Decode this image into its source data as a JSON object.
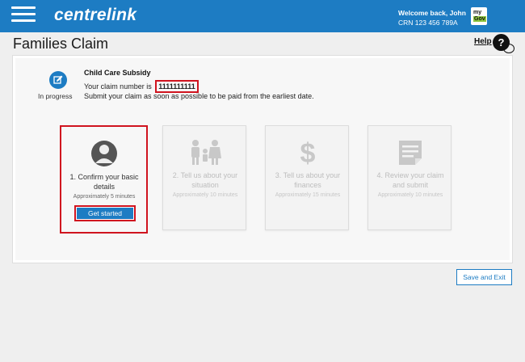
{
  "header": {
    "brand": "centrelink",
    "welcome": "Welcome back, John",
    "crn": "CRN 123 456 789A",
    "mygov_top": "my",
    "mygov_bottom": "Gov"
  },
  "page": {
    "title": "Families Claim",
    "help_label": "Help",
    "help_icon_glyph": "?"
  },
  "claim": {
    "status_label": "In progress",
    "title": "Child Care Subsidy",
    "number_prefix": "Your claim number is",
    "number": "1111111111",
    "submit_note": "Submit your claim as soon as possible to be paid from the earliest date."
  },
  "steps": [
    {
      "title": "1. Confirm your basic details",
      "duration": "Approximately 5 minutes",
      "icon": "person-icon",
      "active": true,
      "button_label": "Get started"
    },
    {
      "title": "2. Tell us about your situation",
      "duration": "Approximately 10 minutes",
      "icon": "family-icon",
      "active": false
    },
    {
      "title": "3. Tell us about your finances",
      "duration": "Approximately 15 minutes",
      "icon": "dollar-icon",
      "active": false
    },
    {
      "title": "4. Review your claim and submit",
      "duration": "Approximately 10 minutes",
      "icon": "document-icon",
      "active": false
    }
  ],
  "actions": {
    "save_exit": "Save and Exit"
  },
  "colors": {
    "brand_blue": "#1d7cc3",
    "highlight_red": "#d0141f",
    "mygov_green": "#8dc63f"
  }
}
